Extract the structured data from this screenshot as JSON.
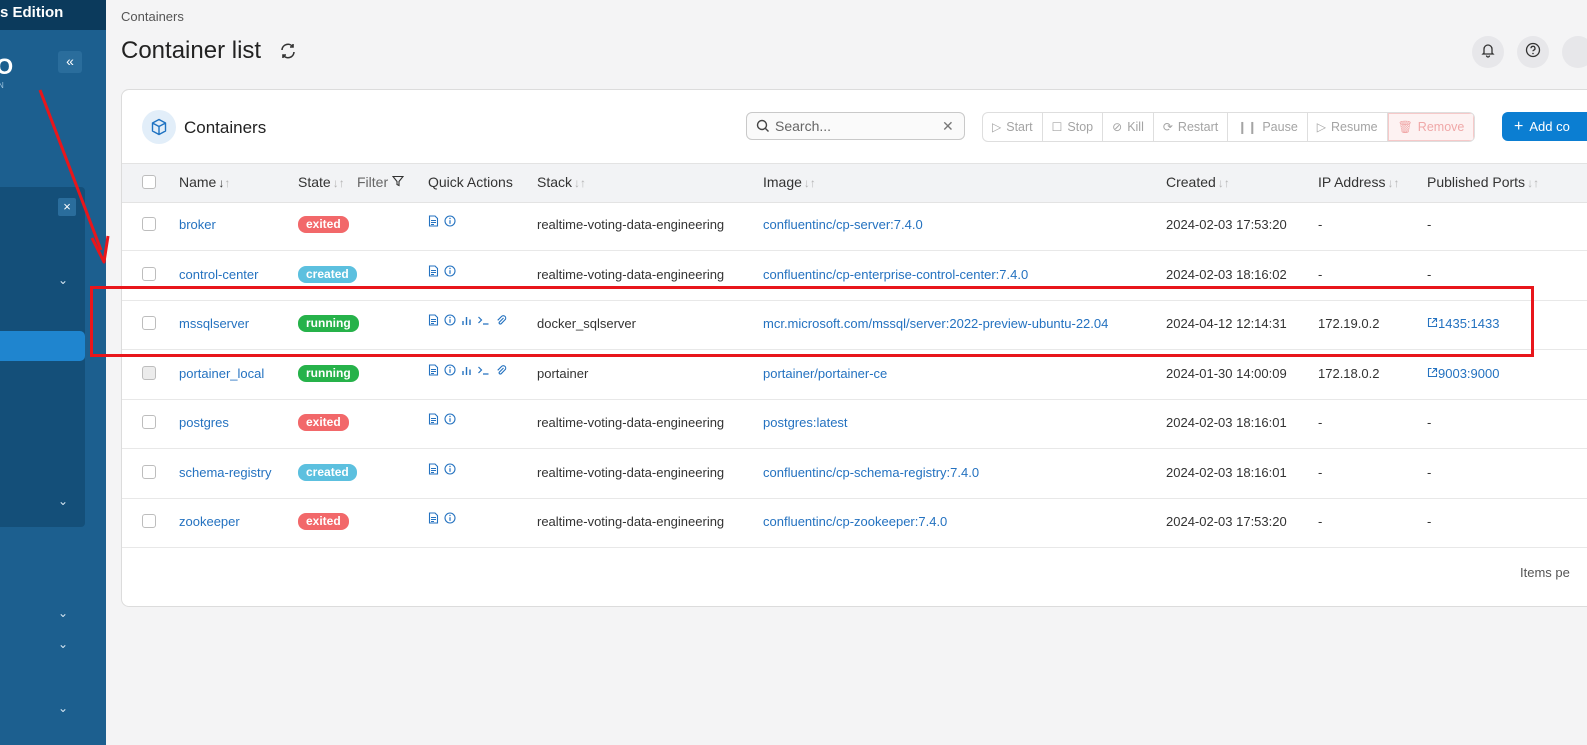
{
  "sidebar": {
    "edition_text": "s Edition",
    "logo_char": "O",
    "logo_sub": "N",
    "collapse_glyph": "«",
    "close_glyph": "×",
    "chevron_glyph": "⌄"
  },
  "header": {
    "breadcrumb": "Containers",
    "title": "Container list"
  },
  "card": {
    "title": "Containers",
    "search_placeholder": "Search...",
    "actions": [
      "Start",
      "Stop",
      "Kill",
      "Restart",
      "Pause",
      "Resume",
      "Remove"
    ],
    "add_label": "Add co",
    "footer": "Items pe"
  },
  "table": {
    "columns": {
      "name": "Name",
      "state": "State",
      "filter": "Filter",
      "quick_actions": "Quick Actions",
      "stack": "Stack",
      "image": "Image",
      "created": "Created",
      "ip": "IP Address",
      "ports": "Published Ports"
    },
    "rows": [
      {
        "name": "broker",
        "state": "exited",
        "stack": "realtime-voting-data-engineering",
        "image": "confluentinc/cp-server:7.4.0",
        "created": "2024-02-03 17:53:20",
        "ip": "-",
        "ports": "-"
      },
      {
        "name": "control-center",
        "state": "created",
        "stack": "realtime-voting-data-engineering",
        "image": "confluentinc/cp-enterprise-control-center:7.4.0",
        "created": "2024-02-03 18:16:02",
        "ip": "-",
        "ports": "-"
      },
      {
        "name": "mssqlserver",
        "state": "running",
        "stack": "docker_sqlserver",
        "image": "mcr.microsoft.com/mssql/server:2022-preview-ubuntu-22.04",
        "created": "2024-04-12 12:14:31",
        "ip": "172.19.0.2",
        "ports": "1435:1433"
      },
      {
        "name": "portainer_local",
        "state": "running",
        "stack": "portainer",
        "image": "portainer/portainer-ce",
        "created": "2024-01-30 14:00:09",
        "ip": "172.18.0.2",
        "ports": "9003:9000"
      },
      {
        "name": "postgres",
        "state": "exited",
        "stack": "realtime-voting-data-engineering",
        "image": "postgres:latest",
        "created": "2024-02-03 18:16:01",
        "ip": "-",
        "ports": "-"
      },
      {
        "name": "schema-registry",
        "state": "created",
        "stack": "realtime-voting-data-engineering",
        "image": "confluentinc/cp-schema-registry:7.4.0",
        "created": "2024-02-03 18:16:01",
        "ip": "-",
        "ports": "-"
      },
      {
        "name": "zookeeper",
        "state": "exited",
        "stack": "realtime-voting-data-engineering",
        "image": "confluentinc/cp-zookeeper:7.4.0",
        "created": "2024-02-03 17:53:20",
        "ip": "-",
        "ports": "-"
      }
    ]
  },
  "colors": {
    "sidebar": "#1c5f8f",
    "accent": "#0b7ed2",
    "exited": "#f2686a",
    "created": "#5cc0df",
    "running": "#26b24a",
    "annotation": "#e8161b"
  },
  "icons": [
    "bell-icon",
    "help-icon",
    "refresh-icon",
    "cube-icon",
    "search-icon",
    "logs-icon",
    "inspect-icon",
    "stats-icon",
    "console-icon",
    "attach-icon",
    "external-link-icon"
  ]
}
